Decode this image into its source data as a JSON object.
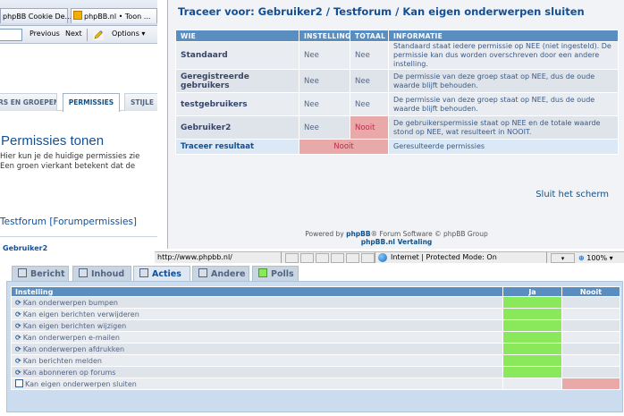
{
  "browser": {
    "tabs": [
      {
        "label": "phpBB Cookie De..."
      },
      {
        "label": "phpBB.nl • Toon ..."
      }
    ],
    "toolbar": {
      "previous": "Previous",
      "next": "Next",
      "options": "Options"
    },
    "status": {
      "url": "http://www.phpbb.nl/",
      "zone": "Internet | Protected Mode: On",
      "zoom": "100%"
    }
  },
  "acp": {
    "tabs": [
      {
        "label": "RS EN GROEPEN"
      },
      {
        "label": "PERMISSIES"
      },
      {
        "label": "STIJLE"
      }
    ],
    "title": "Permissies tonen",
    "description_lines": [
      "Hier kun je de huidige permissies zie",
      "Een groen vierkant betekent dat de"
    ],
    "forum_heading": "Testforum [Forumpermissies]",
    "group_label": "Gebruiker2"
  },
  "trace": {
    "title": "Traceer voor: Gebruiker2 / Testforum / Kan eigen onderwerpen sluiten",
    "headers": {
      "who": "WIE",
      "setting": "INSTELLING",
      "total": "TOTAAL",
      "info": "INFORMATIE"
    },
    "rows": [
      {
        "who": "Standaard",
        "setting": "Nee",
        "total": "Nee",
        "total_state": "nee",
        "info": "Standaard staat iedere permissie op NEE (niet ingesteld). De permissie kan dus worden overschreven door een andere instelling."
      },
      {
        "who": "Geregistreerde gebruikers",
        "setting": "Nee",
        "total": "Nee",
        "total_state": "nee",
        "info": "De permissie van deze groep staat op NEE, dus de oude waarde blijft behouden."
      },
      {
        "who": "testgebruikers",
        "setting": "Nee",
        "total": "Nee",
        "total_state": "nee",
        "info": "De permissie van deze groep staat op NEE, dus de oude waarde blijft behouden."
      },
      {
        "who": "Gebruiker2",
        "setting": "Nee",
        "total": "Nooit",
        "total_state": "nooit",
        "info": "De gebruikerspermissie staat op NEE en de totale waarde stond op NEE, wat resulteert in NOOIT."
      }
    ],
    "result": {
      "label": "Traceer resultaat",
      "value": "Nooit",
      "info": "Geresulteerde permissies"
    },
    "close_link": "Sluit het scherm",
    "footer_line1_pre": "Powered by ",
    "footer_brand": "phpBB",
    "footer_line1_post": "® Forum Software © phpBB Group",
    "footer_line2": "phpBB.nl Vertaling"
  },
  "permission_panel": {
    "tabs": [
      {
        "label": "Bericht",
        "color": "none"
      },
      {
        "label": "Inhoud",
        "color": "none"
      },
      {
        "label": "Acties",
        "color": "none",
        "active": true
      },
      {
        "label": "Andere",
        "color": "none"
      },
      {
        "label": "Polls",
        "color": "green"
      }
    ],
    "headers": {
      "setting": "Instelling",
      "yes": "Ja",
      "never": "Nooit"
    },
    "rows": [
      {
        "label": "Kan onderwerpen bumpen",
        "value": "ja"
      },
      {
        "label": "Kan eigen berichten verwijderen",
        "value": "ja"
      },
      {
        "label": "Kan eigen berichten wijzigen",
        "value": "ja"
      },
      {
        "label": "Kan onderwerpen e-mailen",
        "value": "ja"
      },
      {
        "label": "Kan onderwerpen afdrukken",
        "value": "ja"
      },
      {
        "label": "Kan berichten melden",
        "value": "ja"
      },
      {
        "label": "Kan abonneren op forums",
        "value": "ja"
      },
      {
        "label": "Kan eigen onderwerpen sluiten",
        "value": "nooit"
      }
    ],
    "colors": {
      "yes": "#8ae85b",
      "never": "#eaa9a9"
    }
  }
}
